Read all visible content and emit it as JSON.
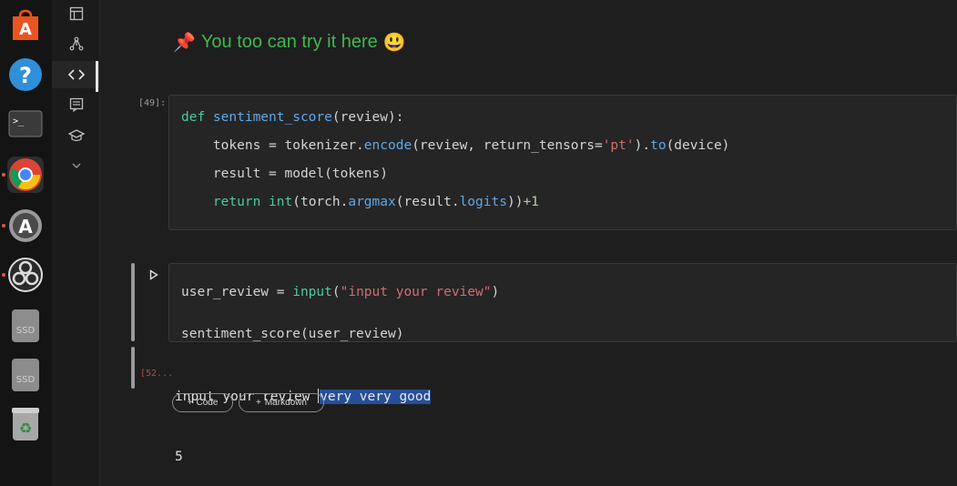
{
  "dock": {
    "items": [
      {
        "name": "app-center-icon",
        "label": "A"
      },
      {
        "name": "help-icon",
        "label": "?"
      },
      {
        "name": "terminal-icon",
        "label": ">_"
      },
      {
        "name": "chrome-icon",
        "label": ""
      },
      {
        "name": "software-updater-icon",
        "label": "A"
      },
      {
        "name": "obs-icon",
        "label": ""
      },
      {
        "name": "drive-icon",
        "label": "SSD"
      },
      {
        "name": "drive-icon",
        "label": "SSD"
      },
      {
        "name": "trash-icon",
        "label": "♻"
      }
    ]
  },
  "notebook": {
    "heading_emoji": "📌",
    "heading_text": "You too can try it here",
    "heading_smiley": "😃",
    "cells": [
      {
        "exec_count": "[49]:",
        "lines": [
          [
            {
              "t": "def ",
              "c": "kw"
            },
            {
              "t": "sentiment_score",
              "c": "fn"
            },
            {
              "t": "(review):",
              "c": ""
            }
          ],
          [
            {
              "t": "    tokens = tokenizer.",
              "c": ""
            },
            {
              "t": "encode",
              "c": "fn"
            },
            {
              "t": "(review, return_tensors=",
              "c": ""
            },
            {
              "t": "'pt'",
              "c": "str"
            },
            {
              "t": ").",
              "c": ""
            },
            {
              "t": "to",
              "c": "fn"
            },
            {
              "t": "(device)",
              "c": ""
            }
          ],
          [
            {
              "t": "    result = model(tokens)",
              "c": ""
            }
          ],
          [
            {
              "t": "    return ",
              "c": "kw"
            },
            {
              "t": "int",
              "c": "kw"
            },
            {
              "t": "(torch.",
              "c": ""
            },
            {
              "t": "argmax",
              "c": "fn"
            },
            {
              "t": "(result.",
              "c": ""
            },
            {
              "t": "logits",
              "c": "fn"
            },
            {
              "t": "))",
              "c": ""
            },
            {
              "t": "+1",
              "c": "num"
            }
          ]
        ]
      },
      {
        "exec_count": "",
        "lines": [
          [
            {
              "t": "user_review = ",
              "c": ""
            },
            {
              "t": "input",
              "c": "kw"
            },
            {
              "t": "(",
              "c": ""
            },
            {
              "t": "\"input your review\"",
              "c": "str"
            },
            {
              "t": ")",
              "c": ""
            }
          ],
          [
            {
              "t": "sentiment_score(user_review)",
              "c": ""
            }
          ]
        ]
      }
    ],
    "output": {
      "exec_count": "[52...",
      "prompt": "input your review ",
      "input_value": "very very good",
      "result": "5"
    },
    "add_code_label": "Code",
    "add_markdown_label": "Markdown"
  },
  "colors": {
    "keyword": "#4ec9a0",
    "function": "#5fa8e8",
    "string": "#ce6f6f",
    "heading": "#3fb950",
    "selection": "#264f9a"
  }
}
